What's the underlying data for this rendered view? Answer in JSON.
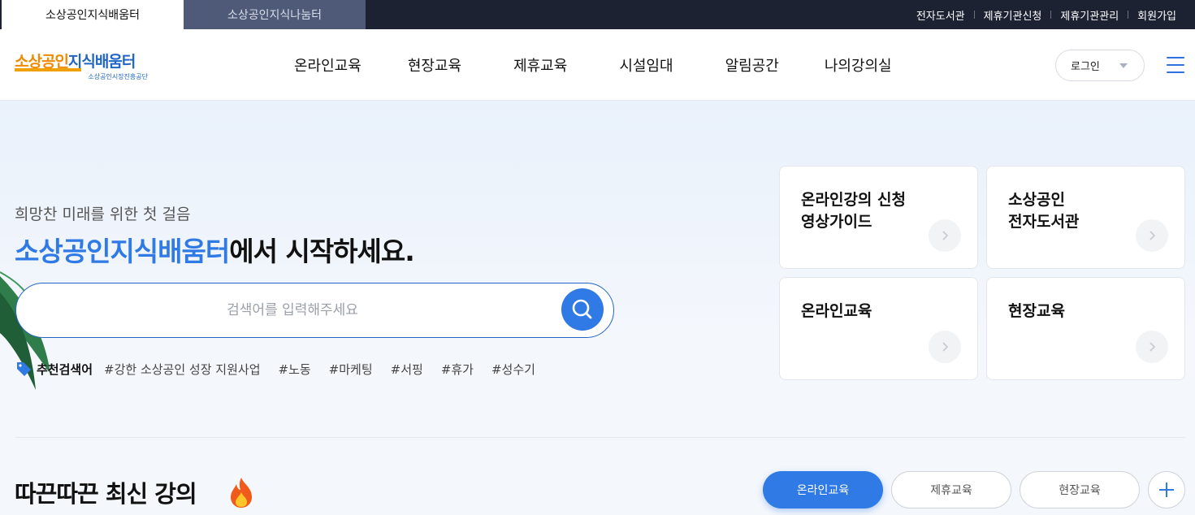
{
  "topbar": {
    "site_tabs": [
      "소상공인지식배움터",
      "소상공인지식나눔터"
    ],
    "links": [
      "전자도서관",
      "제휴기관신청",
      "제휴기관관리",
      "회원가입"
    ]
  },
  "header": {
    "logo_text_orange": "소상공인",
    "logo_text_blue": "지식배움터",
    "logo_sub": "소상공인시장진흥공단",
    "nav": [
      "온라인교육",
      "현장교육",
      "제휴교육",
      "시설임대",
      "알림공간",
      "나의강의실"
    ],
    "login_label": "로그인"
  },
  "hero": {
    "subtitle": "희망찬 미래를 위한 첫 걸음",
    "title_highlight": "소상공인지식배움터",
    "title_rest": "에서 시작하세요.",
    "search_placeholder": "검색어를 입력해주세요",
    "recommend_label": "추천검색어",
    "recommend_tags": [
      "#강한 소상공인 성장 지원사업",
      "#노동",
      "#마케팅",
      "#서핑",
      "#휴가",
      "#성수기"
    ]
  },
  "cards": [
    {
      "title": "온라인강의 신청\n영상가이드"
    },
    {
      "title": "소상공인\n전자도서관"
    },
    {
      "title": "온라인교육"
    },
    {
      "title": "현장교육"
    }
  ],
  "latest": {
    "title": "따끈따끈 최신 강의",
    "filters": [
      "온라인교육",
      "제휴교육",
      "현장교육"
    ],
    "active_filter": "온라인교육"
  },
  "colors": {
    "accent": "#2f7ae5",
    "topbar": "#1d2233",
    "logo_orange": "#f08a00",
    "logo_blue": "#2166c4"
  },
  "icons": [
    "search-icon",
    "tag-icon",
    "chevron-right-icon",
    "fire-icon",
    "plus-icon",
    "hamburger-menu-icon",
    "caret-down-icon"
  ]
}
